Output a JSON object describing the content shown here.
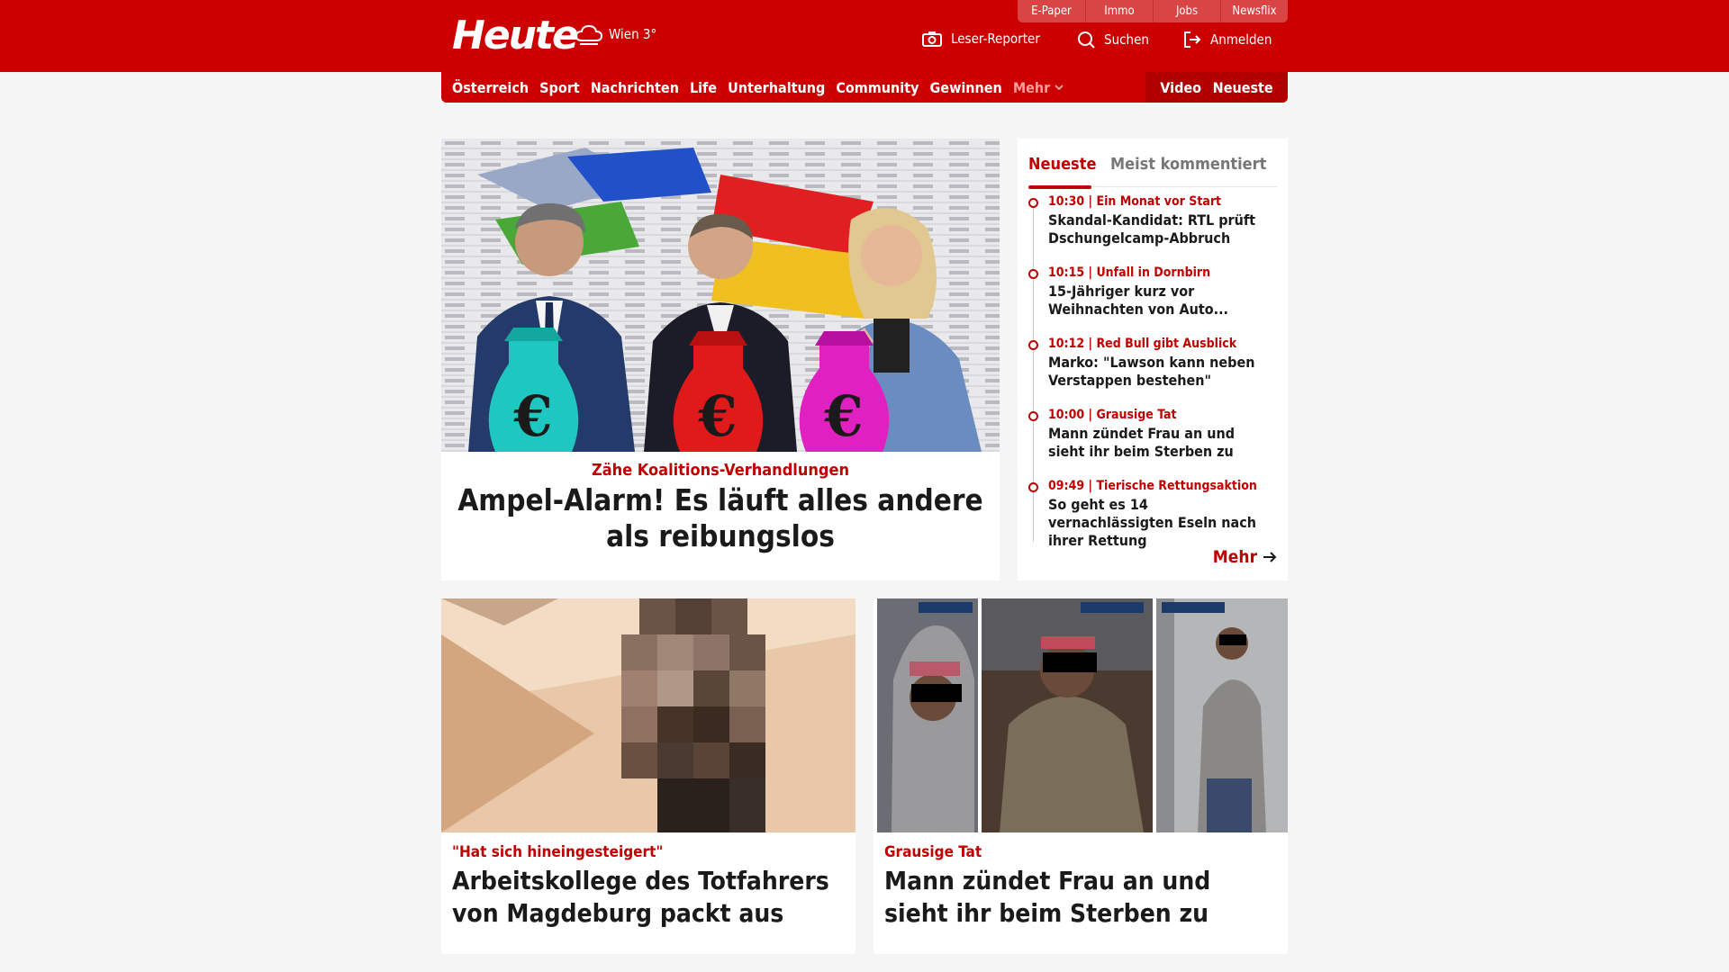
{
  "header": {
    "logo": "Heute",
    "weather": "Wien 3°",
    "top_tabs": [
      "E-Paper",
      "Immo",
      "Jobs",
      "Newsflix"
    ],
    "leser_reporter": "Leser-Reporter",
    "suchen": "Suchen",
    "anmelden": "Anmelden"
  },
  "nav": {
    "items": [
      "Österreich",
      "Sport",
      "Nachrichten",
      "Life",
      "Unterhaltung",
      "Community",
      "Gewinnen"
    ],
    "more": "Mehr",
    "video": "Video",
    "neueste": "Neueste"
  },
  "hero": {
    "kicker": "Zähe Koalitions-Verhandlungen",
    "title": "Ampel-Alarm! Es läuft alles andere als reibungslos"
  },
  "sidebar": {
    "tabs": [
      "Neueste",
      "Meist kommentiert"
    ],
    "items": [
      {
        "meta": "10:30 | Ein Monat vor Start",
        "title": "Skandal-Kandidat: RTL prüft Dschungelcamp-Abbruch"
      },
      {
        "meta": "10:15 | Unfall in Dornbirn",
        "title": "15-Jähriger kurz vor Weihnachten von Auto..."
      },
      {
        "meta": "10:12 | Red Bull gibt Ausblick",
        "title": "Marko: \"Lawson kann neben Verstappen bestehen\""
      },
      {
        "meta": "10:00 | Grausige Tat",
        "title": "Mann zündet Frau an und sieht ihr beim Sterben zu"
      },
      {
        "meta": "09:49 | Tierische Rettungsaktion",
        "title": "So geht es 14 vernachlässigten Eseln nach ihrer Rettung"
      }
    ],
    "more": "Mehr"
  },
  "cards": [
    {
      "kicker": "\"Hat sich hineingesteigert\"",
      "title": "Arbeitskollege des Totfahrers von Magdeburg packt aus"
    },
    {
      "kicker": "Grausige Tat",
      "title": "Mann zündet Frau an und sieht ihr beim Sterben zu"
    }
  ],
  "colors": {
    "brand": "#cc0000",
    "kicker": "#c00000"
  }
}
